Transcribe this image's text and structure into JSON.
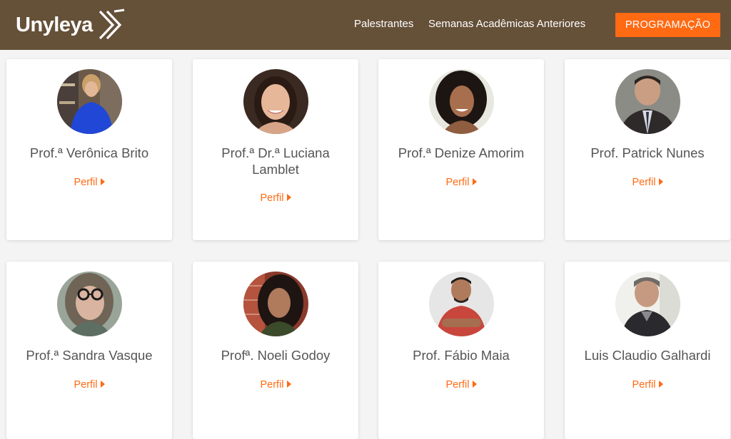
{
  "header": {
    "logo_text": "Unyleya",
    "nav": [
      {
        "label": "Palestrantes"
      },
      {
        "label": "Semanas Acadêmicas Anteriores"
      }
    ],
    "cta_label": "PROGRAMAÇÃO"
  },
  "colors": {
    "header_bg": "#655038",
    "accent": "#ff6a13",
    "card_bg": "#ffffff",
    "name_text": "#555555"
  },
  "speakers": [
    {
      "name": "Prof.ª Verônica Brito",
      "link": "Perfil"
    },
    {
      "name": "Prof.ª Dr.ª Luciana Lamblet",
      "link": "Perfil"
    },
    {
      "name": "Prof.ª Denize Amorim",
      "link": "Perfil"
    },
    {
      "name": "Prof. Patrick Nunes",
      "link": "Perfil"
    },
    {
      "name": "Prof.ª Sandra Vasque",
      "link": "Perfil"
    },
    {
      "name": "Profª. Noeli Godoy",
      "link": "Perfil"
    },
    {
      "name": "Prof. Fábio Maia",
      "link": "Perfil"
    },
    {
      "name": "Luis Claudio Galhardi",
      "link": "Perfil"
    }
  ]
}
